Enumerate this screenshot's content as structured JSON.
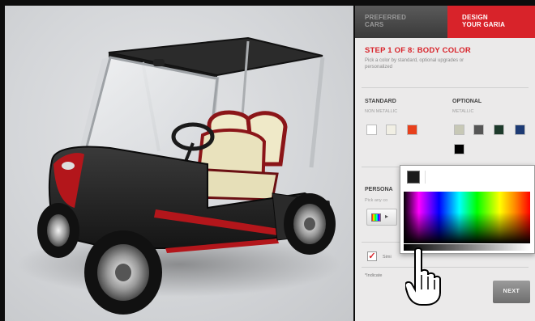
{
  "tabs": {
    "preferred_line1": "PREFERRED",
    "preferred_line2": "CARS",
    "design_line1": "DESIGN",
    "design_line2": "YOUR GARIA"
  },
  "step": {
    "title": "STEP 1 OF 8: BODY COLOR",
    "description": "Pick a color by standard, optional upgrades or personalized"
  },
  "standard": {
    "header": "STANDARD",
    "sub": "NON METALLIC",
    "swatches": [
      "#ffffff",
      "#f1efe4",
      "#e8401c"
    ]
  },
  "optional": {
    "header": "OPTIONAL",
    "sub": "METALLIC",
    "swatches": [
      "#c7c8b6",
      "#565656",
      "#1d3a2b",
      "#1d3b74",
      "#000000"
    ]
  },
  "personal": {
    "header": "PERSONA",
    "sub": "Pick any co"
  },
  "checkbox": {
    "mark": "✓",
    "text": "Simi"
  },
  "footer_text": "*Indicate",
  "next_label": "NEXT",
  "picker": {
    "current_color": "#1b1b1b",
    "cursor": "hand-pointer-icon"
  }
}
